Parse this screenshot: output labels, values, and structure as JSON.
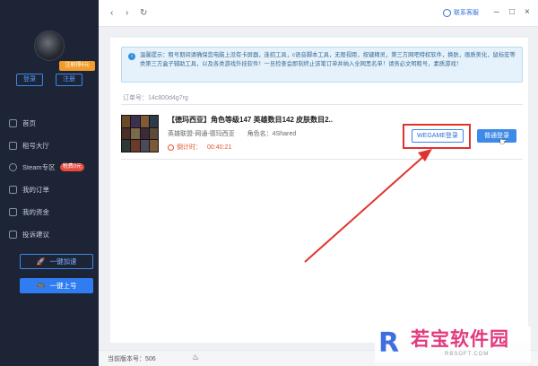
{
  "sidebar": {
    "register_badge": "注册得4元",
    "login_label": "登录",
    "register_label": "注册",
    "nav": [
      {
        "label": "首页",
        "icon": "home-icon"
      },
      {
        "label": "租号大厅",
        "icon": "hall-icon"
      },
      {
        "label": "Steam专区",
        "icon": "steam-icon",
        "badge": "税费0元"
      },
      {
        "label": "我的订单",
        "icon": "order-icon"
      },
      {
        "label": "我的资金",
        "icon": "wallet-icon"
      },
      {
        "label": "投诉建议",
        "icon": "feedback-icon"
      }
    ],
    "accelerate_label": "一键加速",
    "quick_login_label": "一键上号"
  },
  "topbar": {
    "support_label": "联系客服"
  },
  "notice": {
    "text": "温馨提示：租号期间请确保您电脑上没有卡屏器，连招工具，c语音脚本工具，无限视距，按键精灵，第三方网吧特权软件，换肤，画质美化，鼠标宏等类第三方盒子辅助工具，以及各类游戏外挂软件！一旦检查会即刻终止该笔订单并纳入全网黑名单！请务必文明租号，素质游戏！"
  },
  "order": {
    "number_label": "订单号：14c800d4g7rg",
    "title": "【德玛西亚】角色等级147 英雄数目142 皮肤数目2..",
    "platform": "英雄联盟-网通-德玛西亚",
    "role_name": "角色名：4Shared",
    "countdown_label": "倒计时：",
    "countdown_time": "00:40:21",
    "wegame_label": "WEGAME登录",
    "normal_label": "普通登录"
  },
  "footer": {
    "version": "当前版本号：506"
  },
  "watermark": {
    "logo": "R",
    "text": "若宝软件园",
    "sub": "RBSOFT.COM"
  },
  "colors": {
    "sidebar_bg": "#1c2436",
    "accent_blue": "#2f7df0",
    "highlight_red": "#e1332d",
    "countdown_orange": "#e0562e"
  }
}
